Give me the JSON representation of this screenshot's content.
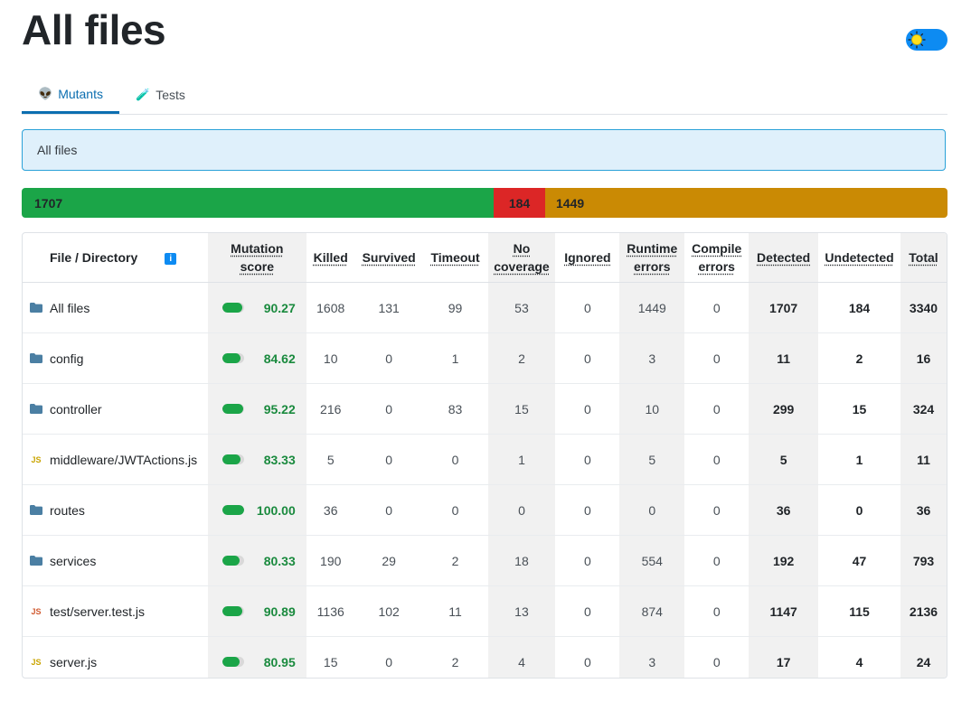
{
  "header": {
    "title": "All files"
  },
  "theme_toggle": {
    "icon": "sun-icon"
  },
  "tabs": [
    {
      "label": "Mutants",
      "icon": "alien-icon",
      "active": true
    },
    {
      "label": "Tests",
      "icon": "test-tube-icon",
      "active": false
    }
  ],
  "breadcrumb": {
    "text": "All files"
  },
  "summary_bar": {
    "detected": "1707",
    "undetected": "184",
    "ignored": "1449",
    "colors": {
      "detected": "#1ba548",
      "undetected": "#dc2626",
      "ignored": "#ca8a04"
    }
  },
  "table": {
    "headers": {
      "file": "File / Directory",
      "score_line1": "Mutation",
      "score_line2": "score",
      "killed": "Killed",
      "survived": "Survived",
      "timeout": "Timeout",
      "nocov_line1": "No",
      "nocov_line2": "coverage",
      "ignored": "Ignored",
      "runtime_line1": "Runtime",
      "runtime_line2": "errors",
      "compile_line1": "Compile",
      "compile_line2": "errors",
      "detected": "Detected",
      "undetected": "Undetected",
      "total": "Total"
    },
    "rows": [
      {
        "icon": "folder-icon",
        "name": "All files",
        "score": "90.27",
        "killed": "1608",
        "survived": "131",
        "timeout": "99",
        "no_coverage": "53",
        "ignored": "0",
        "runtime_errors": "1449",
        "compile_errors": "0",
        "detected": "1707",
        "undetected": "184",
        "total": "3340"
      },
      {
        "icon": "folder-icon",
        "name": "config",
        "score": "84.62",
        "killed": "10",
        "survived": "0",
        "timeout": "1",
        "no_coverage": "2",
        "ignored": "0",
        "runtime_errors": "3",
        "compile_errors": "0",
        "detected": "11",
        "undetected": "2",
        "total": "16"
      },
      {
        "icon": "folder-icon",
        "name": "controller",
        "score": "95.22",
        "killed": "216",
        "survived": "0",
        "timeout": "83",
        "no_coverage": "15",
        "ignored": "0",
        "runtime_errors": "10",
        "compile_errors": "0",
        "detected": "299",
        "undetected": "15",
        "total": "324"
      },
      {
        "icon": "js-file-icon",
        "icon_label": "JS",
        "name": "middleware/JWTActions.js",
        "score": "83.33",
        "killed": "5",
        "survived": "0",
        "timeout": "0",
        "no_coverage": "1",
        "ignored": "0",
        "runtime_errors": "5",
        "compile_errors": "0",
        "detected": "5",
        "undetected": "1",
        "total": "11"
      },
      {
        "icon": "folder-icon",
        "name": "routes",
        "score": "100.00",
        "killed": "36",
        "survived": "0",
        "timeout": "0",
        "no_coverage": "0",
        "ignored": "0",
        "runtime_errors": "0",
        "compile_errors": "0",
        "detected": "36",
        "undetected": "0",
        "total": "36"
      },
      {
        "icon": "folder-icon",
        "name": "services",
        "score": "80.33",
        "killed": "190",
        "survived": "29",
        "timeout": "2",
        "no_coverage": "18",
        "ignored": "0",
        "runtime_errors": "554",
        "compile_errors": "0",
        "detected": "192",
        "undetected": "47",
        "total": "793"
      },
      {
        "icon": "js-test-file-icon",
        "icon_label": "JS",
        "name": "test/server.test.js",
        "score": "90.89",
        "killed": "1136",
        "survived": "102",
        "timeout": "11",
        "no_coverage": "13",
        "ignored": "0",
        "runtime_errors": "874",
        "compile_errors": "0",
        "detected": "1147",
        "undetected": "115",
        "total": "2136"
      },
      {
        "icon": "js-file-icon",
        "icon_label": "JS",
        "name": "server.js",
        "score": "80.95",
        "killed": "15",
        "survived": "0",
        "timeout": "2",
        "no_coverage": "4",
        "ignored": "0",
        "runtime_errors": "3",
        "compile_errors": "0",
        "detected": "17",
        "undetected": "4",
        "total": "24"
      }
    ]
  }
}
